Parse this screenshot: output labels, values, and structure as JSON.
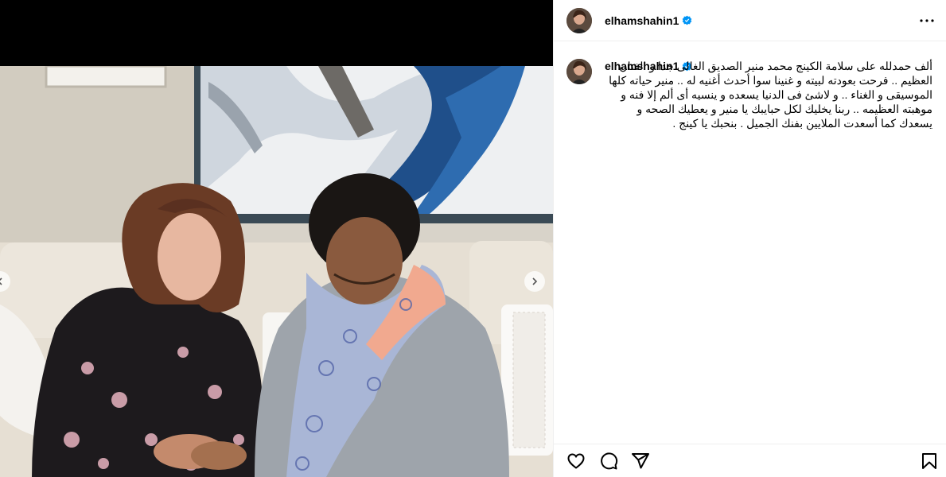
{
  "post": {
    "username": "elhamshahin1",
    "caption": "ألف حمدلله على سلامة الكينج محمد منير الصديق الغالى جدا و الفنان العظيم .. فرحت بعودته لبيته و غنينا سوا أحدث أغنيه له .. منير حياته كلها الموسيقى و الغناء .. و لاشئ فى الدنيا يسعده و ينسيه أى ألم إلا فنه و موهبته العظيمه .. ربنا يخليك لكل حبايبك يا منير و يعطيك الصحه و يسعدك كما أسعدت الملايين بفنك الجميل . بنحبك يا كينج ."
  },
  "icons": {
    "verified": "verified-badge-icon",
    "more": "more-options-icon",
    "like": "heart-icon",
    "comment": "comment-icon",
    "share": "share-icon",
    "save": "bookmark-icon",
    "next": "chevron-right-icon",
    "prev": "chevron-left-icon"
  },
  "colors": {
    "verified": "#0095f6",
    "border": "#efefef",
    "text": "#000000"
  }
}
